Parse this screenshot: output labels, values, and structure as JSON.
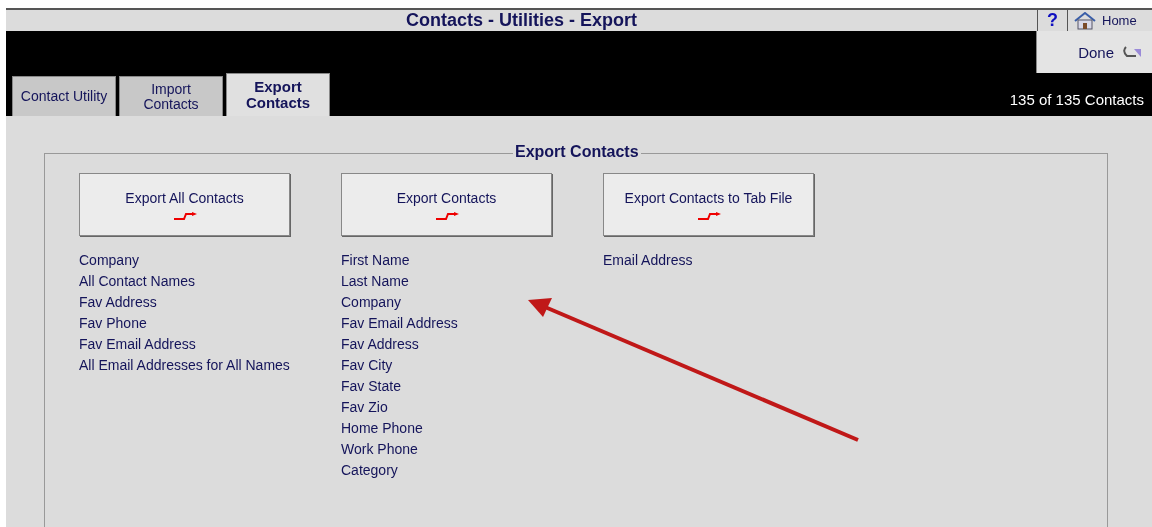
{
  "window": {
    "title": "Contacts - Utilities - Export"
  },
  "help_button": "?",
  "home_button": "Home",
  "done_button": "Done",
  "tabs": [
    {
      "label": "Contact Utility",
      "selected": false
    },
    {
      "label": "Import Contacts",
      "selected": false
    },
    {
      "label": "Export Contacts",
      "selected": true
    }
  ],
  "record_count": "135 of 135 Contacts",
  "group": {
    "title": "Export Contacts",
    "columns": [
      {
        "button": "Export All Contacts",
        "fields": [
          "Company",
          "All Contact Names",
          "Fav Address",
          "Fav Phone",
          "Fav Email Address",
          "All Email Addresses for All Names"
        ]
      },
      {
        "button": "Export Contacts",
        "fields": [
          "First Name",
          "Last Name",
          "Company",
          "Fav Email Address",
          "Fav Address",
          "Fav City",
          "Fav State",
          "Fav Zio",
          "Home Phone",
          "Work Phone",
          "Category"
        ]
      },
      {
        "button": "Export Contacts to Tab File",
        "fields": [
          "Email Address"
        ]
      }
    ]
  }
}
